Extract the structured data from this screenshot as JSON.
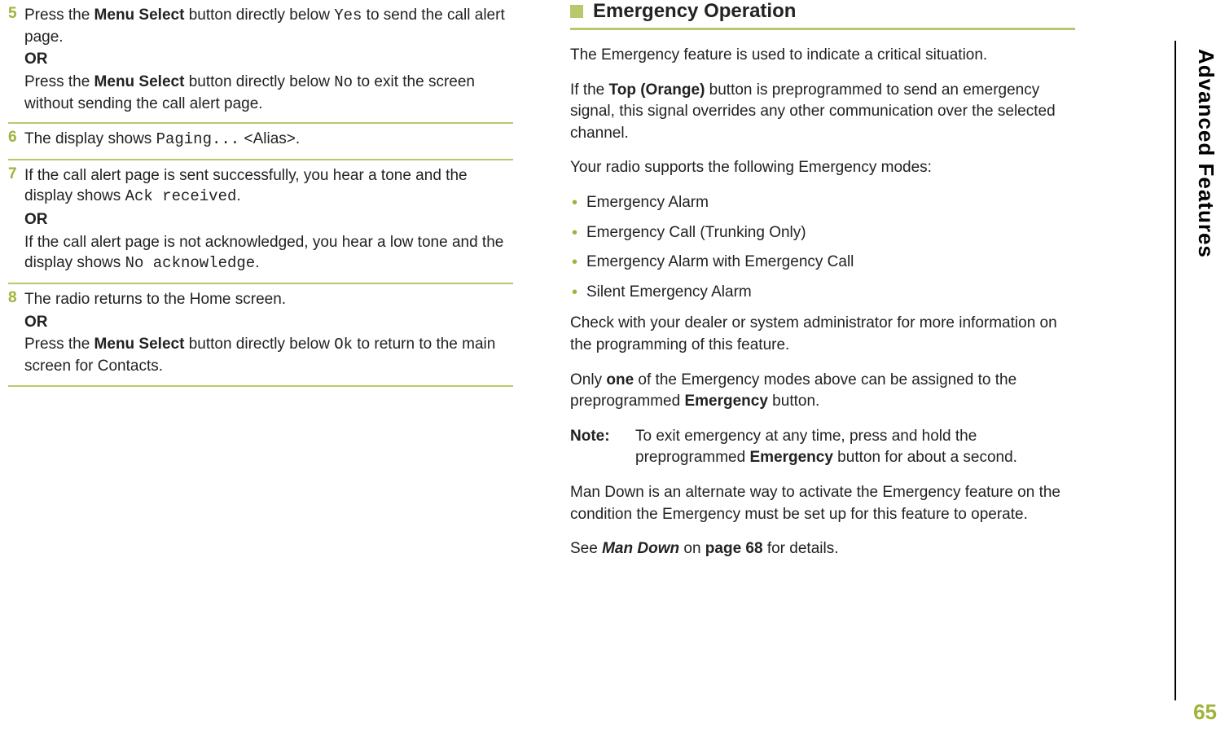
{
  "left": {
    "steps": [
      {
        "num": "5",
        "p1a": "Press the ",
        "p1b": "Menu Select",
        "p1c": " button directly below ",
        "p1d": "Yes",
        "p1e": " to send the call alert page.",
        "or": "OR",
        "p2a": "Press the ",
        "p2b": "Menu Select",
        "p2c": " button directly below ",
        "p2d": "No",
        "p2e": " to exit the screen without sending the call alert page."
      },
      {
        "num": "6",
        "p1a": "The display shows ",
        "p1b": "Paging...",
        "p1c": " <Alias>."
      },
      {
        "num": "7",
        "p1a": "If the call alert page is sent successfully, you hear a tone and the display shows ",
        "p1b": "Ack received",
        "p1c": ".",
        "or": "OR",
        "p2a": "If the call alert page is not acknowledged, you hear a low tone and the display shows ",
        "p2b": "No acknowledge",
        "p2c": "."
      },
      {
        "num": "8",
        "p1a": "The radio returns to the Home screen.",
        "or": "OR",
        "p2a": "Press the ",
        "p2b": "Menu Select",
        "p2c": " button directly below ",
        "p2d": "Ok",
        "p2e": " to return to the main screen for Contacts."
      }
    ]
  },
  "right": {
    "heading": "Emergency Operation",
    "p1": "The Emergency feature is used to indicate a critical situation.",
    "p2a": "If the ",
    "p2b": "Top (Orange)",
    "p2c": " button is preprogrammed to send an emergency signal, this signal overrides any other communication over the selected channel.",
    "p3": "Your radio supports the following Emergency modes:",
    "bullets": [
      "Emergency Alarm",
      "Emergency Call (Trunking Only)",
      "Emergency Alarm with Emergency Call",
      "Silent Emergency Alarm"
    ],
    "p4": "Check with your dealer or system administrator for more information on the programming of this feature.",
    "p5a": "Only ",
    "p5b": "one",
    "p5c": " of the Emergency modes above can be assigned to the preprogrammed ",
    "p5d": "Emergency",
    "p5e": " button.",
    "noteLabel": "Note:",
    "noteA": "To exit emergency at any time, press and hold the preprogrammed ",
    "noteB": "Emergency",
    "noteC": " button for about a second.",
    "p6": "Man Down is an alternate way to activate the Emergency feature on the condition the Emergency must be set up for this feature to operate.",
    "p7a": "See ",
    "p7b": "Man Down",
    "p7c": " on ",
    "p7d": "page 68",
    "p7e": " for details."
  },
  "sidetab": "Advanced Features",
  "pagenum": "65"
}
